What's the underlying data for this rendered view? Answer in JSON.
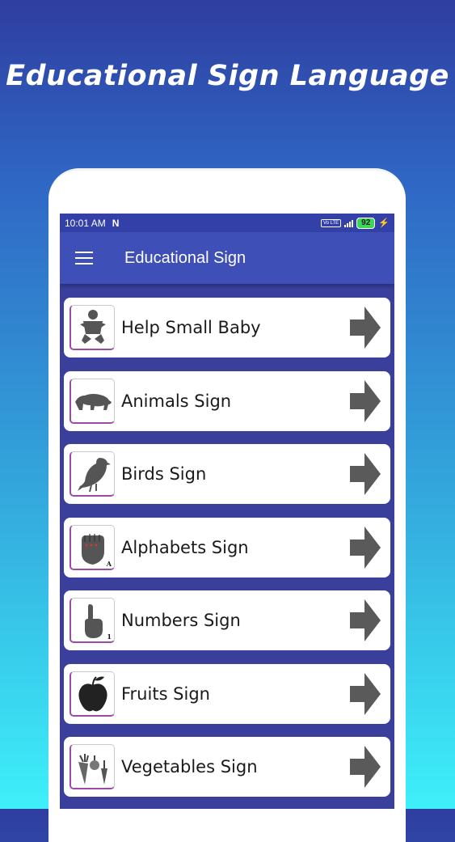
{
  "headline": "Educational Sign Language",
  "status_bar": {
    "time": "10:01 AM",
    "network_logo": "N",
    "volte": "Vo LTE",
    "battery": "92"
  },
  "app_bar": {
    "title": "Educational  Sign",
    "menu_icon": "hamburger-menu-icon"
  },
  "categories": [
    {
      "label": "Help Small Baby",
      "icon": "baby-icon"
    },
    {
      "label": "Animals Sign",
      "icon": "bear-icon"
    },
    {
      "label": "Birds Sign",
      "icon": "bird-icon"
    },
    {
      "label": "Alphabets Sign",
      "icon": "hand-sign-a-icon",
      "sub": "A"
    },
    {
      "label": "Numbers Sign",
      "icon": "hand-sign-one-icon",
      "sub": "1"
    },
    {
      "label": "Fruits Sign",
      "icon": "apple-icon"
    },
    {
      "label": "Vegetables Sign",
      "icon": "vegetables-icon"
    }
  ],
  "colors": {
    "background_top": "#2f3ea0",
    "background_bottom": "#3ef0fa",
    "app_bar": "#3f4fb8",
    "list_background": "#3a3f9c",
    "icon_gray": "#555555",
    "thumb_accent": "#9b4aa5"
  }
}
